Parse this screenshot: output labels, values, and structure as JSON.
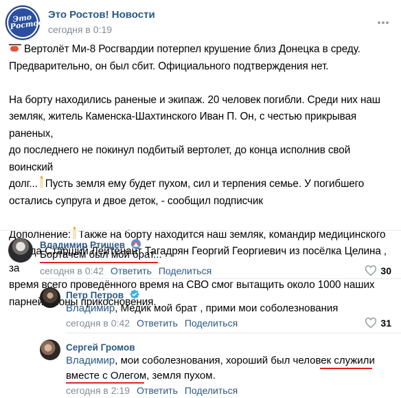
{
  "group": {
    "name": "Это Ростов! Новости",
    "time": "сегодня в 0:19",
    "logo_text": "Это Ростов"
  },
  "post": {
    "p1_line1": "Вертолёт Ми-8 Росгвардии потерпел крушение близ Донецка в среду.",
    "p1_line2": "Предварительно, он был сбит. Официального подтверждения нет.",
    "p2_line1": "На борту находились раненые и экипаж. 20 человек погибли. Среди них наш",
    "p2_line2": "земляк, житель Каменска-Шахтинского Иван П. Он, с честью прикрывая раненых,",
    "p2_line3": "до последнего не покинул подбитый вертолет, до конца исполнив свой воинский",
    "p2_line4a": "долг...",
    "p2_line4b": "Пусть земля ему будет пухом, сил и терпения семье. У погибшего",
    "p2_line5": "остались супруга и двое деток, - сообщил подписчик",
    "p3_line1a": "Дополнение:",
    "p3_line1b": "Также на борту находится наш земляк, командир медицинского",
    "p3_line2": "взвода Старший Лейтенант Тагадрян Георгий Георгиевич из посёлка Целина , за",
    "p3_line3": "время всего проведённого время на СВО смог вытащить около 1000 наших",
    "p3_line4": "парней с зоны прикосновения."
  },
  "comments": [
    {
      "name": "Владимир Ртищев",
      "text": "Бортачем был мой брат...",
      "time": "сегодня в 0:42",
      "reply": "Ответить",
      "share": "Поделиться",
      "likes": "30"
    },
    {
      "name": "Петр Петров",
      "mention": "Владимир",
      "text": ", Медик мой брат , прими мои соболезнования",
      "time": "сегодня в 0:42",
      "reply": "Ответить",
      "share": "Поделиться",
      "likes": "31"
    },
    {
      "name": "Сергей Громов",
      "mention": "Владимир",
      "text_line1": ", мои соболезнования, хороший был человек служили",
      "text_line2": "вместе с Олегом, земля пухом.",
      "time": "сегодня в 2:19",
      "reply": "Ответить",
      "share": "Поделиться"
    }
  ],
  "colors": {
    "link": "#2a5885",
    "meta": "#818c99",
    "underline": "#e02020"
  },
  "icons": [
    "more-dots-icon",
    "helicopter-icon",
    "candle-icon",
    "heart-icon",
    "badge-icon"
  ]
}
